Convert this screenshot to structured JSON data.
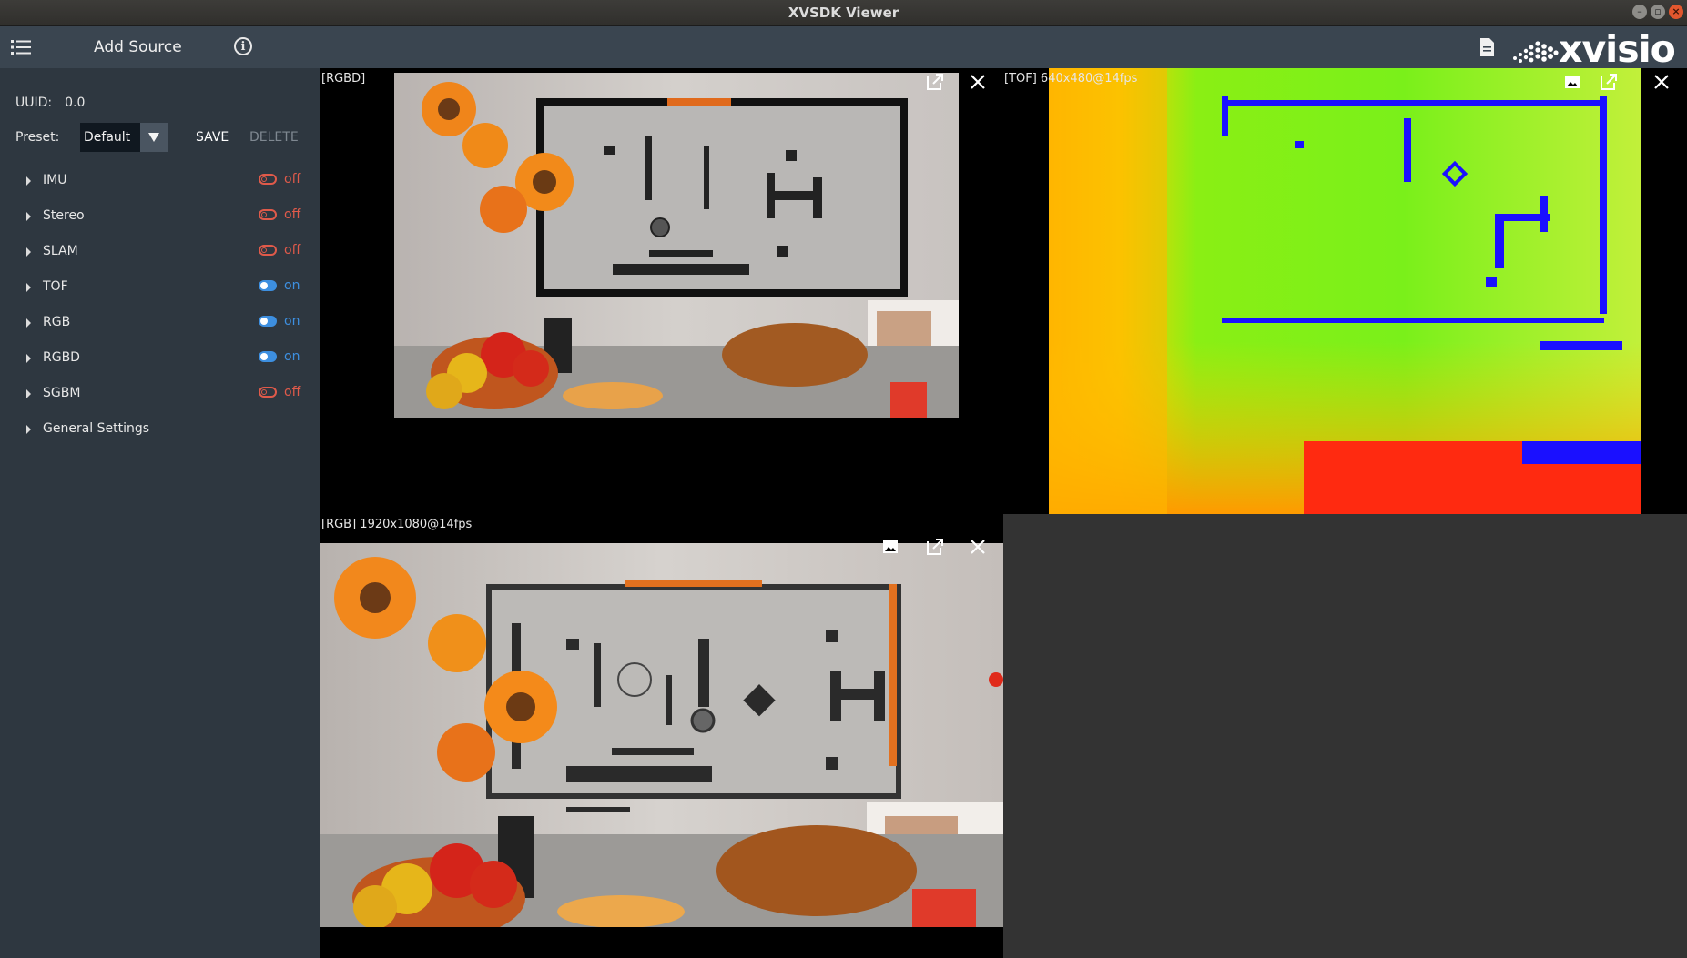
{
  "window": {
    "title": "XVSDK Viewer"
  },
  "toolbar": {
    "menu_icon": "list-icon",
    "add_source_label": "Add Source",
    "info_icon": "info-icon",
    "doc_icon": "document-icon",
    "brand": "xvisio"
  },
  "sidebar": {
    "uuid_label": "UUID:",
    "uuid_value": "0.0",
    "preset_label": "Preset:",
    "preset_value": "Default",
    "save_label": "SAVE",
    "delete_label": "DELETE",
    "items": [
      {
        "label": "IMU",
        "state": "off"
      },
      {
        "label": "Stereo",
        "state": "off"
      },
      {
        "label": "SLAM",
        "state": "off"
      },
      {
        "label": "TOF",
        "state": "on"
      },
      {
        "label": "RGB",
        "state": "on"
      },
      {
        "label": "RGBD",
        "state": "on"
      },
      {
        "label": "SGBM",
        "state": "off"
      },
      {
        "label": "General Settings",
        "state": ""
      }
    ]
  },
  "panels": {
    "rgbd": {
      "label": "[RGBD]"
    },
    "tof": {
      "label": "[TOF]  640x480@14fps"
    },
    "rgb": {
      "label": "[RGB]  1920x1080@14fps"
    }
  },
  "colors": {
    "sidebar_bg": "#2e3740",
    "toolbar_bg": "#3a4550",
    "on_color": "#3d8fe0",
    "off_color": "#e05a4a"
  }
}
